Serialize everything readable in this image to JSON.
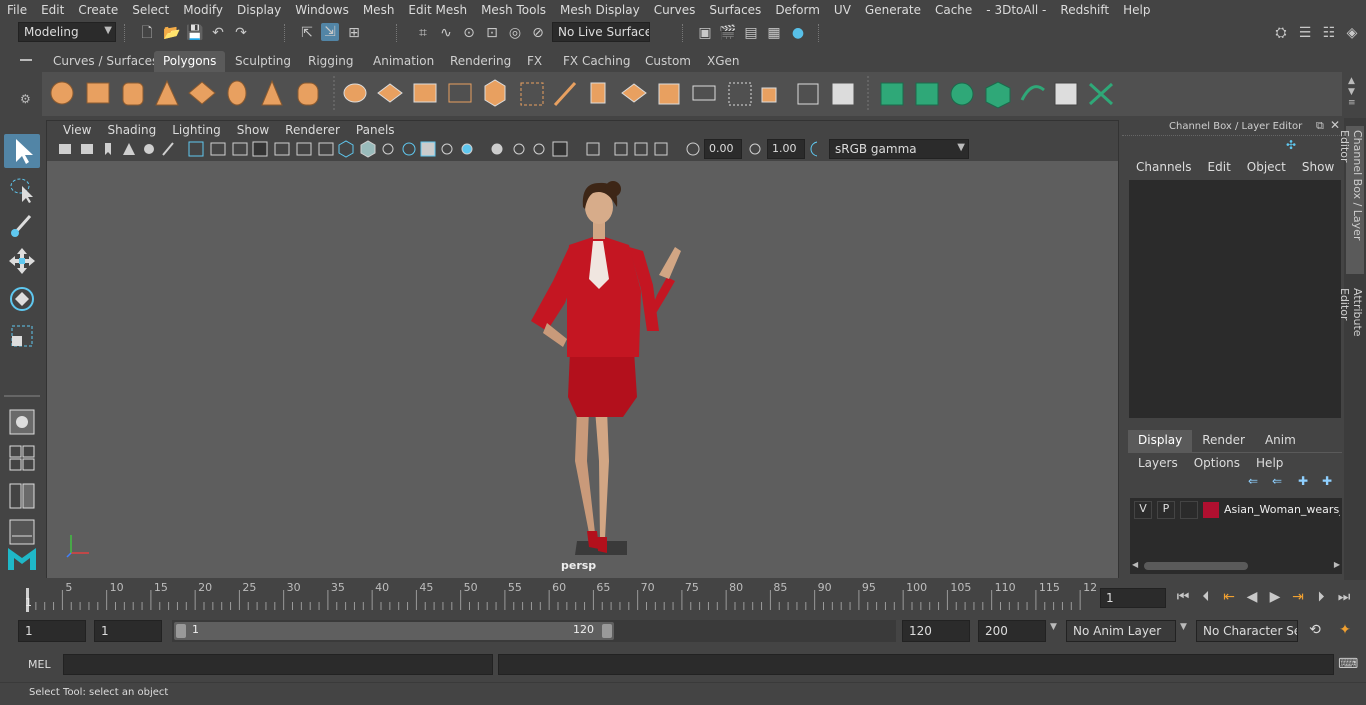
{
  "menubar": [
    "File",
    "Edit",
    "Create",
    "Select",
    "Modify",
    "Display",
    "Windows",
    "Mesh",
    "Edit Mesh",
    "Mesh Tools",
    "Mesh Display",
    "Curves",
    "Surfaces",
    "Deform",
    "UV",
    "Generate",
    "Cache",
    "- 3DtoAll -",
    "Redshift",
    "Help"
  ],
  "toolbar": {
    "mode": "Modeling",
    "live_surface": "No Live Surface"
  },
  "shelf_tabs": [
    "Curves / Surfaces",
    "Polygons",
    "Sculpting",
    "Rigging",
    "Animation",
    "Rendering",
    "FX",
    "FX Caching",
    "Custom",
    "XGen"
  ],
  "shelf_active": "Polygons",
  "viewport": {
    "menus": [
      "View",
      "Shading",
      "Lighting",
      "Show",
      "Renderer",
      "Panels"
    ],
    "exposure": "0.00",
    "gamma": "1.00",
    "color_space": "sRGB gamma",
    "camera": "persp"
  },
  "channel_box": {
    "title": "Channel Box / Layer Editor",
    "menus": [
      "Channels",
      "Edit",
      "Object",
      "Show"
    ],
    "tabs": [
      "Display",
      "Render",
      "Anim"
    ],
    "layer_menus": [
      "Layers",
      "Options",
      "Help"
    ],
    "layer": {
      "v": "V",
      "p": "P",
      "name": "Asian_Woman_wears_",
      "color": "#b01030"
    }
  },
  "side_tabs": [
    "Channel Box / Layer Editor",
    "Attribute Editor"
  ],
  "timeline": {
    "ticks": [
      "5",
      "10",
      "15",
      "20",
      "25",
      "30",
      "35",
      "40",
      "45",
      "50",
      "55",
      "60",
      "65",
      "70",
      "75",
      "80",
      "85",
      "90",
      "95",
      "100",
      "105",
      "110",
      "115",
      "12"
    ],
    "current_frame_label": "1",
    "current_frame": "1"
  },
  "range": {
    "start": "1",
    "start2": "1",
    "slider_start": "1",
    "slider_end": "120",
    "end": "120",
    "end2": "200",
    "anim_layer": "No Anim Layer",
    "char_set": "No Character Set"
  },
  "cmd": {
    "label": "MEL"
  },
  "help": {
    "text": "Select Tool: select an object"
  },
  "colors": {
    "accent": "#5285a6",
    "shelf_orange": "#e8a060",
    "shelf_green": "#2fa878",
    "suit": "#b3101c"
  }
}
